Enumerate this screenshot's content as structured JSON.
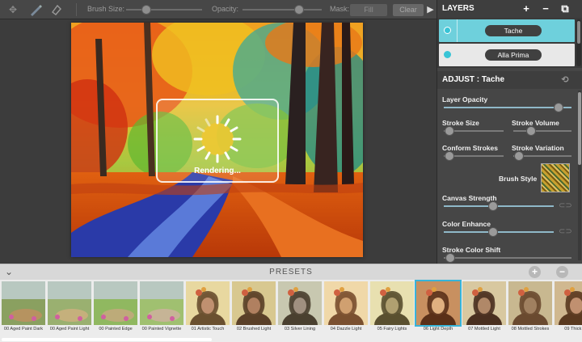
{
  "toolbar": {
    "brush_size_label": "Brush Size:",
    "brush_size_value": 0.05,
    "opacity_label": "Opacity:",
    "opacity_value": 0.8,
    "mask_label": "Mask:",
    "fill_label": "Fill",
    "clear_label": "Clear",
    "collapse_icon": "chevron-right-icon"
  },
  "canvas": {
    "rendering_text": "Rendering..."
  },
  "layers": {
    "title": "LAYERS",
    "items": [
      {
        "name": "Tache",
        "selected": true
      },
      {
        "name": "Alla Prima",
        "selected": false
      }
    ]
  },
  "adjust": {
    "title": "ADJUST : Tache",
    "layer_opacity_label": "Layer Opacity",
    "layer_opacity": 0.9,
    "stroke_size_label": "Stroke Size",
    "stroke_size": 0.1,
    "stroke_volume_label": "Stroke Volume",
    "stroke_volume": 0.3,
    "conform_strokes_label": "Conform Strokes",
    "conform_strokes": 0.1,
    "stroke_variation_label": "Stroke Variation",
    "stroke_variation": 0.1,
    "brush_style_label": "Brush Style",
    "canvas_strength_label": "Canvas Strength",
    "canvas_strength": 0.45,
    "color_enhance_label": "Color Enhance",
    "color_enhance": 0.45,
    "stroke_color_shift_label": "Stroke Color Shift",
    "stroke_color_shift": 0.05
  },
  "presets": {
    "title": "PRESETS",
    "items": [
      {
        "label": "00 Aged Paint Dark"
      },
      {
        "label": "00 Aged Paint Light"
      },
      {
        "label": "00 Painted Edge"
      },
      {
        "label": "00 Painted Vignette"
      },
      {
        "label": "01 Artistic Touch"
      },
      {
        "label": "02 Brushed Light"
      },
      {
        "label": "03 Silver Lining"
      },
      {
        "label": "04 Dazzle Light"
      },
      {
        "label": "05 Fairy Lights"
      },
      {
        "label": "06 Light Depth",
        "active": true
      },
      {
        "label": "07 Mottled Light"
      },
      {
        "label": "08 Mottled Strokes"
      },
      {
        "label": "09 Thick Pa"
      }
    ]
  },
  "colors": {
    "accent": "#38b4d8",
    "layer_selected": "#6ed0dc"
  }
}
